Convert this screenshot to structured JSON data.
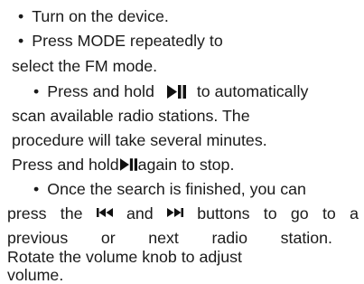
{
  "instructions": {
    "bullet_symbol": "•",
    "step1": {
      "text": "Turn on the device."
    },
    "step2": {
      "line1": "Press MODE repeatedly to",
      "line2": "select the FM mode."
    },
    "step3": {
      "line1_before": "Press and hold",
      "line1_after": "to automatically",
      "line2": "scan available radio stations. The",
      "line3": "procedure will take several minutes.",
      "line4_before": "Press and hold",
      "line4_after": "again to stop.",
      "icon": "play-pause-icon"
    },
    "step4": {
      "line1": "Once the search is finished, you can",
      "line2_words": [
        "press",
        "the",
        "and",
        "buttons",
        "to",
        "go",
        "to",
        "a"
      ],
      "line3_words": [
        "previous",
        "or",
        "next",
        "radio",
        "station."
      ],
      "line4": "Rotate the volume knob to adjust",
      "line5": "volume.",
      "prev_icon": "skip-previous-icon",
      "next_icon": "skip-next-icon"
    }
  },
  "colors": {
    "text": "#1a1a1a",
    "icon": "#111111",
    "background": "#ffffff"
  }
}
